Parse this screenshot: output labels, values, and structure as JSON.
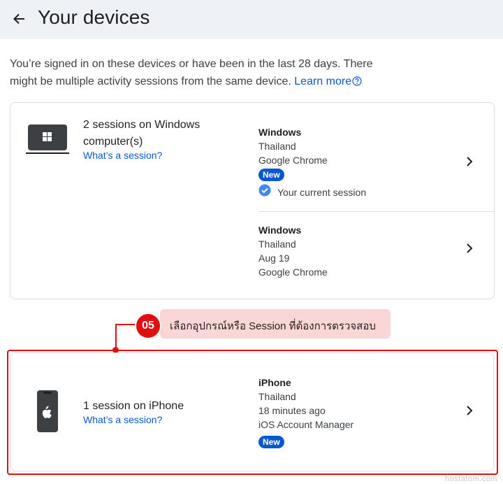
{
  "header": {
    "title": "Your devices"
  },
  "intro": {
    "text": "You’re signed in on these devices or have been in the last 28 days. There might be multiple activity sessions from the same device.",
    "learn_more": "Learn more"
  },
  "devices": [
    {
      "title": "2 sessions on Windows computer(s)",
      "link": "What’s a session?",
      "icon": "windows-laptop-icon",
      "sessions": [
        {
          "os": "Windows",
          "location": "Thailand",
          "browser": "Google Chrome",
          "badge": "New",
          "current": "Your current session"
        },
        {
          "os": "Windows",
          "location": "Thailand",
          "date": "Aug 19",
          "browser": "Google Chrome"
        }
      ]
    },
    {
      "title": "1 session on iPhone",
      "link": "What’s a session?",
      "icon": "iphone-icon",
      "sessions": [
        {
          "os": "iPhone",
          "location": "Thailand",
          "time": "18 minutes ago",
          "app": "iOS Account Manager",
          "badge": "New"
        }
      ]
    }
  ],
  "annotation": {
    "step": "05",
    "text": "เลือกอุปกรณ์หรือ Session ที่ต้องการตรวจสอบ"
  },
  "watermark": "hostatom.com",
  "colors": {
    "accent": "#0b57d0",
    "annotation": "#e01010",
    "callout_bg": "#fbd6d6",
    "topbar_bg": "#eef1f6"
  }
}
